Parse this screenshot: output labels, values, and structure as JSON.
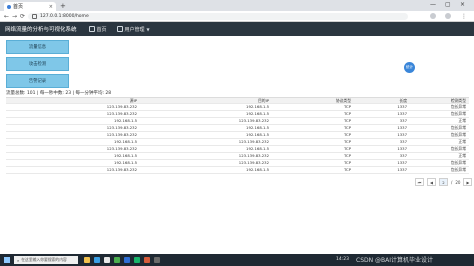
{
  "browser": {
    "tab_title": "首页",
    "tab_close": "×",
    "new_tab": "+",
    "url": "127.0.0.1:8000/home",
    "window_controls": [
      "—",
      "▢",
      "×"
    ]
  },
  "app": {
    "title": "网络流量的分析与可视化系统",
    "nav": [
      {
        "label": "首页",
        "icon": "home-icon"
      },
      {
        "label": "用户管理",
        "icon": "users-icon"
      }
    ]
  },
  "side_buttons": [
    "流量信息",
    "攻击检测",
    "告警记录"
  ],
  "fab_label": "统计",
  "stats_text": "流量总数: 101 | 每一秒中数: 23 | 每一分钟平均: 28",
  "table": {
    "columns": [
      "源IP",
      "目的IP",
      "协议类型",
      "长度",
      "检测类型"
    ],
    "rows": [
      [
        "123.139.83.232",
        "192.168.1.5",
        "TCP",
        "1337",
        "包长异常"
      ],
      [
        "123.139.83.232",
        "192.168.1.5",
        "TCP",
        "1337",
        "包长异常"
      ],
      [
        "192.168.1.5",
        "123.139.83.232",
        "TCP",
        "337",
        "正常"
      ],
      [
        "123.139.83.232",
        "192.168.1.5",
        "TCP",
        "1337",
        "包长异常"
      ],
      [
        "123.139.83.232",
        "192.168.1.5",
        "TCP",
        "1337",
        "包长异常"
      ],
      [
        "192.168.1.5",
        "123.139.83.232",
        "TCP",
        "337",
        "正常"
      ],
      [
        "123.139.83.232",
        "192.168.1.5",
        "TCP",
        "1337",
        "包长异常"
      ],
      [
        "192.168.1.5",
        "123.139.83.232",
        "TCP",
        "337",
        "正常"
      ],
      [
        "192.168.1.5",
        "123.139.83.232",
        "TCP",
        "1337",
        "包长异常"
      ],
      [
        "123.139.83.232",
        "192.168.1.5",
        "TCP",
        "1337",
        "包长异常"
      ]
    ]
  },
  "pagination": {
    "first": "⏮",
    "prev": "◀",
    "current": "2",
    "separator": "/",
    "total": "20",
    "next": "▶",
    "last": "⏭"
  },
  "taskbar": {
    "search_placeholder": "在这里输入你要搜索的内容",
    "time": "14:23",
    "date": "2023/3/8"
  },
  "watermark": "CSDN @BAI计算机毕业设计"
}
